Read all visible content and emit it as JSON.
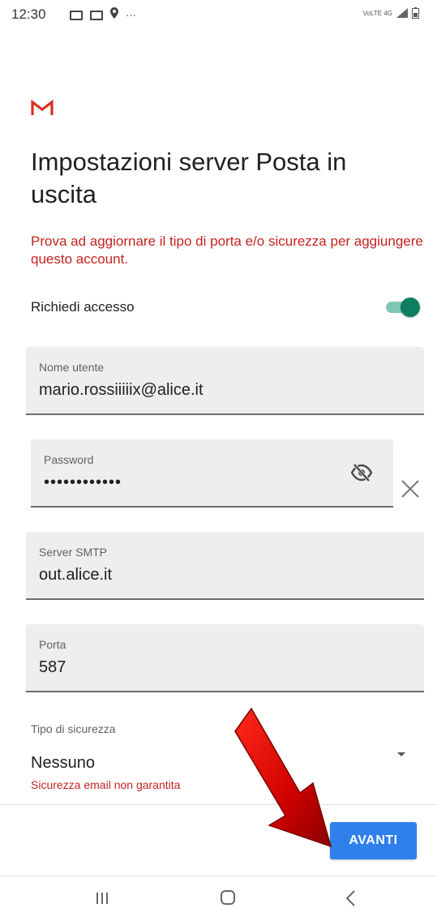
{
  "status_bar": {
    "time": "12:30",
    "more": "···",
    "network": "VoLTE 4G"
  },
  "header": {
    "logo": "gmail-logo",
    "title": "Impostazioni server Posta in uscita"
  },
  "error_message": "Prova ad aggiornare il tipo di porta e/o sicurezza per aggiungere questo account.",
  "require_login": {
    "label": "Richiedi accesso",
    "enabled": true
  },
  "fields": {
    "username": {
      "label": "Nome utente",
      "value": "mario.rossiiiiix@alice.it"
    },
    "password": {
      "label": "Password",
      "value": "••••••••••••"
    },
    "smtp_server": {
      "label": "Server SMTP",
      "value": "out.alice.it"
    },
    "port": {
      "label": "Porta",
      "value": "587"
    }
  },
  "security": {
    "label": "Tipo di sicurezza",
    "selected": "Nessuno",
    "warning": "Sicurezza email non garantita"
  },
  "actions": {
    "next_label": "AVANTI"
  },
  "colors": {
    "accent_blue": "#2f80ed",
    "error_red": "#c5221f",
    "toggle_green": "#0b7f60",
    "annotation_arrow": "#d10000"
  },
  "nav_bar": {
    "recents_icon": "recents-icon",
    "home_icon": "home-icon",
    "back_icon": "back-icon"
  }
}
